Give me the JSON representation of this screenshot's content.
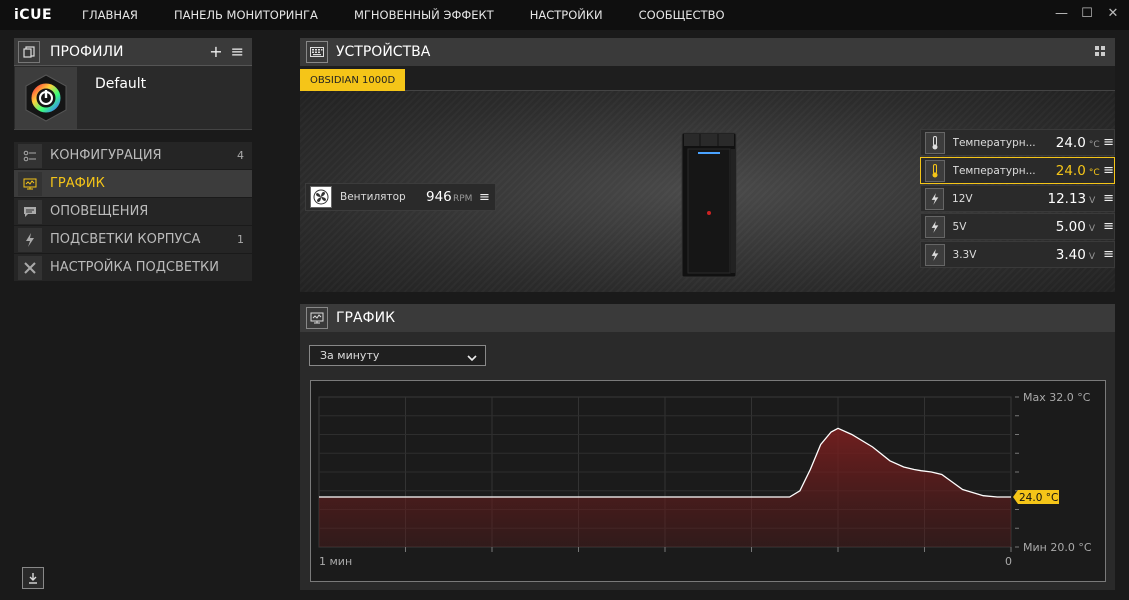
{
  "app": {
    "logo": "iCUE"
  },
  "nav": {
    "items": [
      "ГЛАВНАЯ",
      "ПАНЕЛЬ МОНИТОРИНГА",
      "МГНОВЕННЫЙ ЭФФЕКТ",
      "НАСТРОЙКИ",
      "СООБЩЕСТВО"
    ]
  },
  "profiles": {
    "title": "ПРОФИЛИ",
    "current": "Default"
  },
  "menu": {
    "items": [
      {
        "label": "КОНФИГУРАЦИЯ",
        "count": "4",
        "icon": "sliders-icon",
        "active": false
      },
      {
        "label": "ГРАФИК",
        "count": "",
        "icon": "monitor-graph-icon",
        "active": true
      },
      {
        "label": "ОПОВЕЩЕНИЯ",
        "count": "",
        "icon": "message-icon",
        "active": false
      },
      {
        "label": "ПОДСВЕТКИ КОРПУСА",
        "count": "1",
        "icon": "lightning-icon",
        "active": false
      },
      {
        "label": "НАСТРОЙКА ПОДСВЕТКИ",
        "count": "",
        "icon": "tools-icon",
        "active": false
      }
    ]
  },
  "devices": {
    "title": "УСТРОЙСТВА",
    "tab": "OBSIDIAN 1000D",
    "fan": {
      "label": "Вентилятор",
      "value": "946",
      "unit": "RPM"
    },
    "sensors": [
      {
        "label": "Температурн...",
        "value": "24.0",
        "unit": "°C",
        "icon": "thermometer-icon",
        "selected": false
      },
      {
        "label": "Температурн...",
        "value": "24.0",
        "unit": "°C",
        "icon": "thermometer-icon",
        "selected": true
      },
      {
        "label": "12V",
        "value": "12.13",
        "unit": "V",
        "icon": "lightning-icon",
        "selected": false
      },
      {
        "label": "5V",
        "value": "5.00",
        "unit": "V",
        "icon": "lightning-icon",
        "selected": false
      },
      {
        "label": "3.3V",
        "value": "3.40",
        "unit": "V",
        "icon": "lightning-icon",
        "selected": false
      }
    ]
  },
  "graph": {
    "title": "ГРАФИК",
    "range": "За минуту",
    "max_label": "Max 32.0 °C",
    "min_label": "Мин 20.0 °C",
    "current_label": "24.0 °C",
    "x_start": "1 мин",
    "x_end": "0"
  },
  "chart_data": {
    "type": "area",
    "ylim": [
      20,
      32
    ],
    "current": 24.0,
    "x": [
      0,
      0.68,
      0.695,
      0.71,
      0.725,
      0.74,
      0.75,
      0.77,
      0.8,
      0.825,
      0.845,
      0.86,
      0.87,
      0.885,
      0.9,
      0.915,
      0.93,
      0.96,
      0.98,
      1.0
    ],
    "values": [
      24.0,
      24.0,
      24.5,
      26.2,
      28.2,
      29.2,
      29.5,
      29.0,
      28.0,
      26.9,
      26.4,
      26.2,
      26.1,
      26.0,
      25.8,
      25.2,
      24.6,
      24.1,
      24.0,
      24.0
    ],
    "colors": {
      "line": "#ffffff",
      "fill": "#5a1a1a",
      "marker": "#f5c518"
    }
  }
}
